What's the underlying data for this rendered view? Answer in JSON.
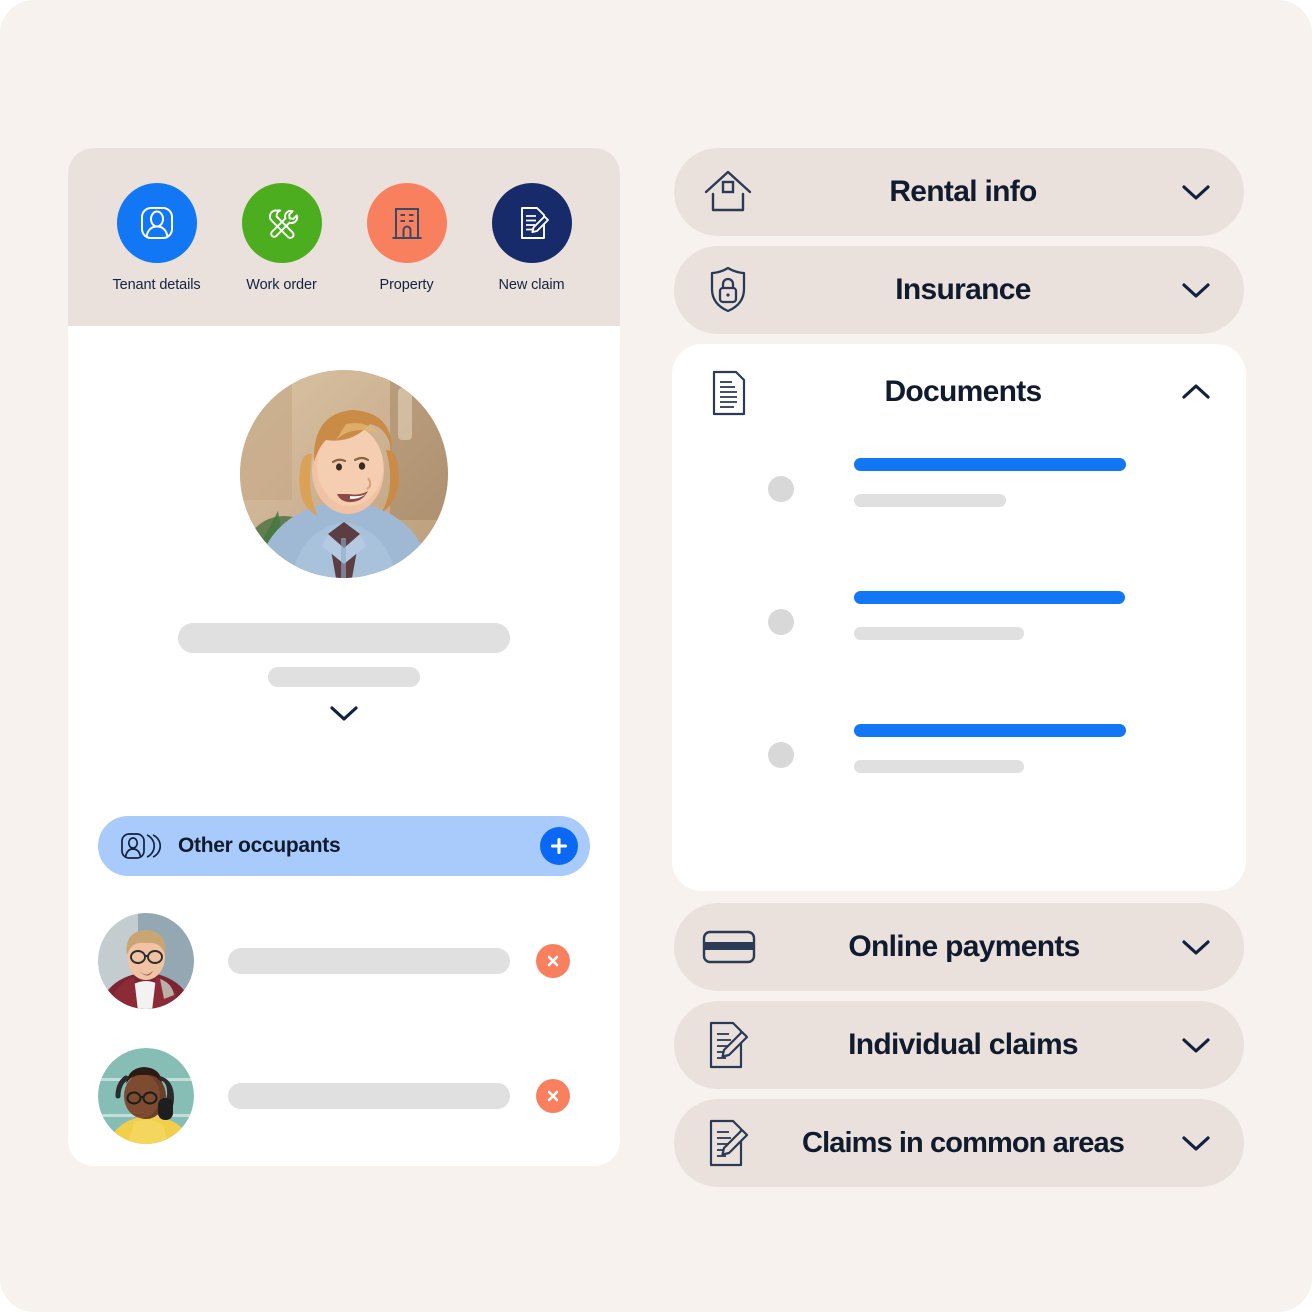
{
  "theme": {
    "page_bg": "#f7f2ee",
    "card_bg": "#ffffff",
    "pill_bg": "#eae1dc",
    "accent_blue": "#1177f5",
    "navy": "#101b2d",
    "coral": "#f9805f",
    "green": "#4cae1f",
    "dark_navy": "#172b6b",
    "occupant_bar_bg": "#a9cbfb",
    "skeleton_grey": "#e0e0e0"
  },
  "left_card": {
    "quick_actions": [
      {
        "label": "Tenant details",
        "icon": "person-card-icon",
        "circle_color": "#1177f5"
      },
      {
        "label": "Work order",
        "icon": "tools-icon",
        "circle_color": "#4cae1f"
      },
      {
        "label": "Property",
        "icon": "building-icon",
        "circle_color": "#f9805f"
      },
      {
        "label": "New claim",
        "icon": "document-pen-icon",
        "circle_color": "#172b6b"
      }
    ],
    "profile": {
      "avatar_name": "tenant-avatar",
      "name_placeholder": "",
      "subtitle_placeholder": "",
      "expand_icon": "chevron-down-icon"
    },
    "occupants": {
      "title": "Other occupants",
      "icon": "people-stack-icon",
      "add_icon": "plus-icon",
      "rows": [
        {
          "avatar_name": "occupant-avatar-1",
          "name_placeholder": "",
          "remove_icon": "close-icon"
        },
        {
          "avatar_name": "occupant-avatar-2",
          "name_placeholder": "",
          "remove_icon": "close-icon"
        }
      ]
    }
  },
  "right_column": {
    "sections": [
      {
        "title": "Rental info",
        "icon": "house-icon",
        "expanded": false,
        "chevron": "chevron-down-icon"
      },
      {
        "title": "Insurance",
        "icon": "shield-lock-icon",
        "expanded": false,
        "chevron": "chevron-down-icon"
      },
      {
        "title": "Documents",
        "icon": "document-lines-icon",
        "expanded": true,
        "chevron": "chevron-up-icon"
      },
      {
        "title": "Online payments",
        "icon": "credit-card-icon",
        "expanded": false,
        "chevron": "chevron-down-icon"
      },
      {
        "title": "Individual claims",
        "icon": "document-pen-icon",
        "expanded": false,
        "chevron": "chevron-down-icon"
      },
      {
        "title": "Claims in common areas",
        "icon": "document-pen-icon",
        "expanded": false,
        "chevron": "chevron-down-icon"
      }
    ],
    "documents_list": [
      {
        "title_placeholder": "",
        "subtitle_placeholder": "",
        "title_width": 272,
        "subtitle_width": 152
      },
      {
        "title_placeholder": "",
        "subtitle_placeholder": "",
        "title_width": 271,
        "subtitle_width": 170
      },
      {
        "title_placeholder": "",
        "subtitle_placeholder": "",
        "title_width": 272,
        "subtitle_width": 170
      }
    ]
  }
}
